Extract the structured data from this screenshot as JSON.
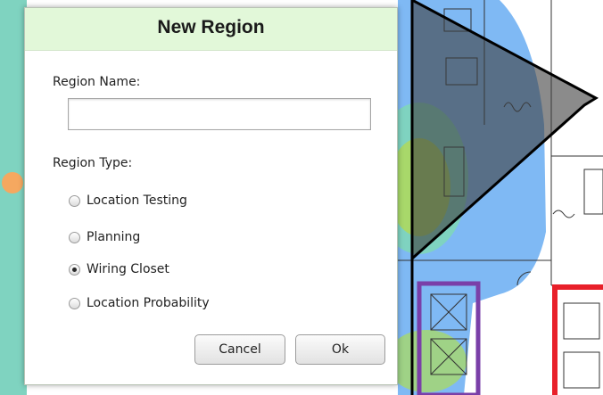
{
  "dialog": {
    "title": "New Region",
    "region_name_label": "Region Name:",
    "region_name_value": "",
    "region_type_label": "Region Type:",
    "region_types": [
      {
        "label": "Location Testing",
        "checked": false
      },
      {
        "label": "Planning",
        "checked": false
      },
      {
        "label": "Wiring Closet",
        "checked": true
      },
      {
        "label": "Location Probability",
        "checked": false
      }
    ],
    "cancel_label": "Cancel",
    "ok_label": "Ok"
  },
  "colors": {
    "header_background": "#e2f8d9",
    "heatmap_blue": "#7fb9f4",
    "heatmap_teal": "#7fd3c0",
    "heatmap_green": "#a8d86a",
    "wall_red": "#e8202a",
    "wall_purple": "#7a3fa8",
    "region_polygon": "#3d3d3d"
  }
}
